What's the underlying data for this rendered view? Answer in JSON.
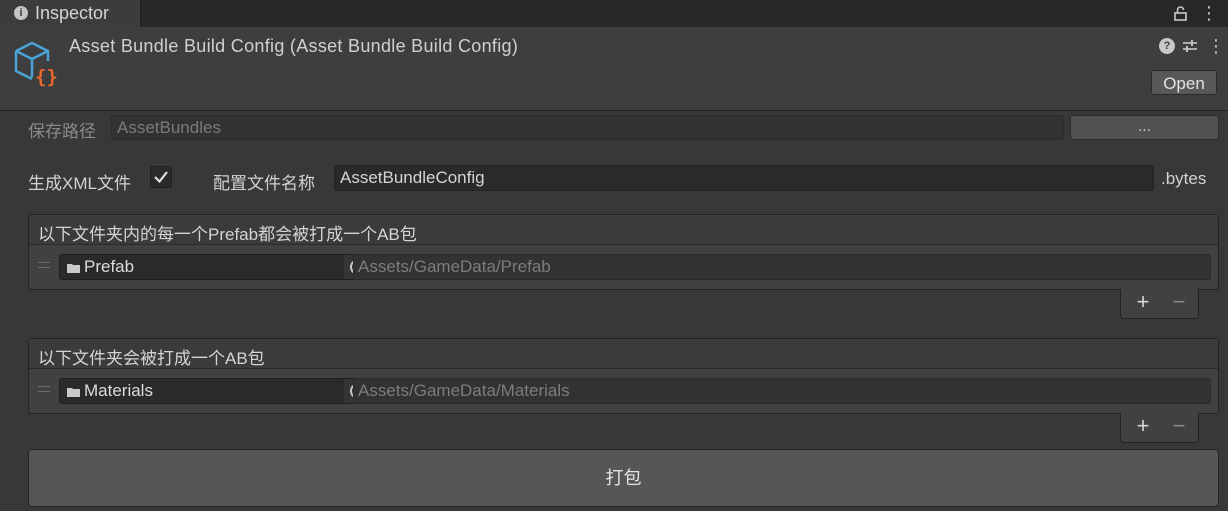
{
  "window": {
    "tab_label": "Inspector"
  },
  "header": {
    "title": "Asset Bundle Build Config (Asset Bundle Build Config)",
    "open_label": "Open"
  },
  "save_path": {
    "label": "保存路径",
    "value": "AssetBundles",
    "browse_label": "..."
  },
  "xml_row": {
    "generate_label": "生成XML文件",
    "generate_checked": true,
    "config_name_label": "配置文件名称",
    "config_name_value": "AssetBundleConfig",
    "suffix": ".bytes"
  },
  "prefab_list": {
    "header": "以下文件夹内的每一个Prefab都会被打成一个AB包",
    "items": [
      {
        "object": "Prefab",
        "path": "Assets/GameData/Prefab"
      }
    ]
  },
  "folder_list": {
    "header": "以下文件夹会被打成一个AB包",
    "items": [
      {
        "object": "Materials",
        "path": "Assets/GameData/Materials"
      }
    ]
  },
  "list_controls": {
    "add": "+",
    "remove": "−"
  },
  "build_button": {
    "label": "打包"
  },
  "icons": {
    "tab": "info-icon",
    "lock": "lock-icon",
    "asset": "scriptable-object-icon",
    "help": "help-icon",
    "presets": "presets-icon",
    "menu": "kebab-menu-icon",
    "folder": "folder-icon",
    "picker": "object-picker-icon",
    "checkbox": "checkmark-icon"
  },
  "colors": {
    "background": "#383838",
    "asset_icon_cube": "#4ba3d8",
    "asset_icon_braces": "#e8672d"
  }
}
